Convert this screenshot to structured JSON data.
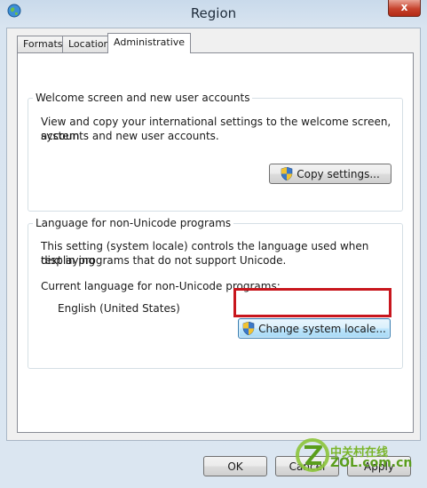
{
  "window": {
    "title": "Region",
    "close_label": "x"
  },
  "tabs": [
    {
      "label": "Formats",
      "active": false
    },
    {
      "label": "Location",
      "active": false
    },
    {
      "label": "Administrative",
      "active": true
    }
  ],
  "welcome_group": {
    "legend": "Welcome screen and new user accounts",
    "description_line1": "View and copy your international settings to the welcome screen, system",
    "description_line2": "accounts and new user accounts.",
    "copy_button": "Copy settings..."
  },
  "locale_group": {
    "legend": "Language for non-Unicode programs",
    "description_line1": "This setting (system locale) controls the language used when displaying",
    "description_line2": "text in programs that do not support Unicode.",
    "current_label": "Current language for non-Unicode programs:",
    "current_value": "English (United States)",
    "change_button": "Change system locale..."
  },
  "footer": {
    "ok": "OK",
    "cancel": "Cancel",
    "apply": "Apply"
  },
  "watermark": {
    "cn": "中关村在线",
    "en": "ZOL.com.cn"
  },
  "colors": {
    "highlight": "#c8161d",
    "watermark": "#7ab52a"
  },
  "icons": {
    "title": "globe-icon",
    "shield": "uac-shield-icon",
    "watermark": "zol-logo"
  }
}
